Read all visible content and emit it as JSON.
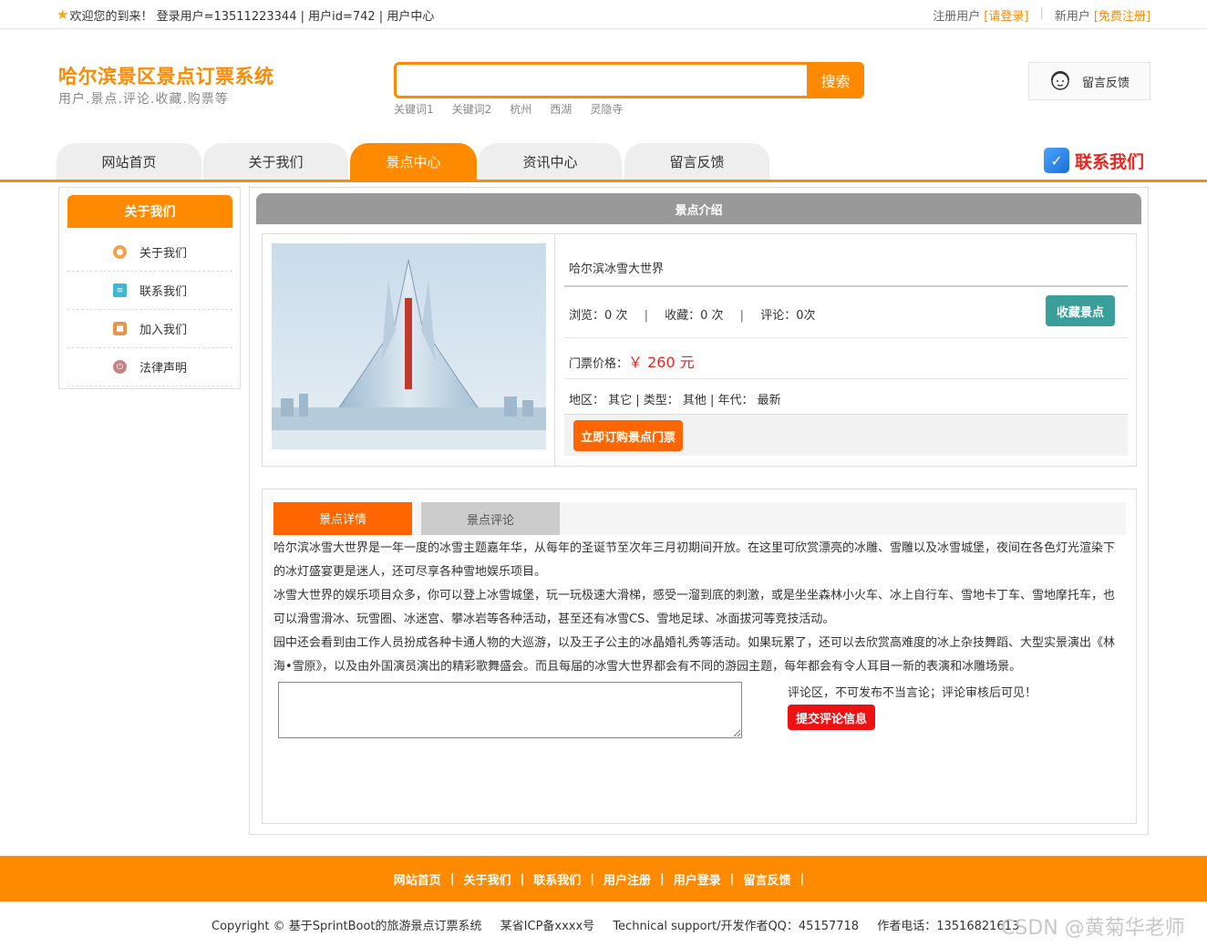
{
  "topbar": {
    "welcome": "欢迎您的到来！ 登录用户=13511223344 | 用户id=742 | 用户中心",
    "register_user_text": "注册用户",
    "login_link": "[请登录]",
    "new_user_text": "新用户",
    "free_register_link": "[免费注册]"
  },
  "header": {
    "title": "哈尔滨景区景点订票系统",
    "subtitle": "用户.景点.评论.收藏.购票等"
  },
  "search": {
    "placeholder": "",
    "button": "搜索",
    "keywords": [
      "关键词1",
      "关键词2",
      "杭州",
      "西湖",
      "灵隐寺"
    ]
  },
  "feedback_label": "留言反馈",
  "nav": {
    "tabs": [
      {
        "label": "网站首页",
        "active": false
      },
      {
        "label": "关于我们",
        "active": false
      },
      {
        "label": "景点中心",
        "active": true
      },
      {
        "label": "资讯中心",
        "active": false
      },
      {
        "label": "留言反馈",
        "active": false
      }
    ],
    "contact": "联系我们"
  },
  "sidebar": {
    "title": "关于我们",
    "items": [
      {
        "label": "关于我们",
        "icon": "about-icon"
      },
      {
        "label": "联系我们",
        "icon": "clipboard-icon"
      },
      {
        "label": "加入我们",
        "icon": "lock-icon"
      },
      {
        "label": "法律声明",
        "icon": "power-icon"
      }
    ]
  },
  "main": {
    "title": "景点介绍",
    "spot": {
      "name": "哈尔滨冰雪大世界",
      "views_label": "浏览：",
      "views": "0 次",
      "favs_label": "收藏：",
      "favs": "0 次",
      "comments_label": "评论：",
      "comments": "0次",
      "favorite_button": "收藏景点",
      "price_label": "门票价格：",
      "price": "￥ 260 元",
      "meta": "地区： 其它 | 类型： 其他 | 年代： 最新",
      "buy_button": "立即订购景点门票"
    },
    "tabs": {
      "details": "景点详情",
      "reviews": "景点评论"
    },
    "description": [
      "哈尔滨冰雪大世界是一年一度的冰雪主题嘉年华，从每年的圣诞节至次年三月初期间开放。在这里可欣赏漂亮的冰雕、雪雕以及冰雪城堡，夜间在各色灯光渲染下的冰灯盛宴更是迷人，还可尽享各种雪地娱乐项目。",
      "冰雪大世界的娱乐项目众多，你可以登上冰雪城堡，玩一玩极速大滑梯，感受一溜到底的刺激，或是坐坐森林小火车、冰上自行车、雪地卡丁车、雪地摩托车，也可以滑雪滑冰、玩雪圈、冰迷宫、攀冰岩等各种活动，甚至还有冰雪CS、雪地足球、冰面拔河等竞技活动。",
      "园中还会看到由工作人员扮成各种卡通人物的大巡游，以及王子公主的冰晶婚礼秀等活动。如果玩累了，还可以去欣赏高难度的冰上杂技舞蹈、大型实景演出《林海•雪原》，以及由外国演员演出的精彩歌舞盛会。而且每届的冰雪大世界都会有不同的游园主题，每年都会有令人耳目一新的表演和冰雕场景。"
    ],
    "comment": {
      "tip": "评论区，不可发布不当言论；评论审核后可见！",
      "submit": "提交评论信息"
    }
  },
  "footer": {
    "links": [
      "网站首页",
      "关于我们",
      "联系我们",
      "用户注册",
      "用户登录",
      "留言反馈"
    ],
    "copyright": "Copyright © 基于SprintBoot的旅游景点订票系统",
    "icp": "某省ICP备xxxx号",
    "support": "Technical support/开发作者QQ：45157718",
    "phone": "作者电话：13516821613",
    "watermark": "CSDN @黄菊华老师"
  },
  "colors": {
    "accent": "#ff8a00",
    "buy": "#ff6600",
    "price": "#e8261f",
    "fav_button": "#3a9e9b",
    "submit": "#ee1111"
  }
}
